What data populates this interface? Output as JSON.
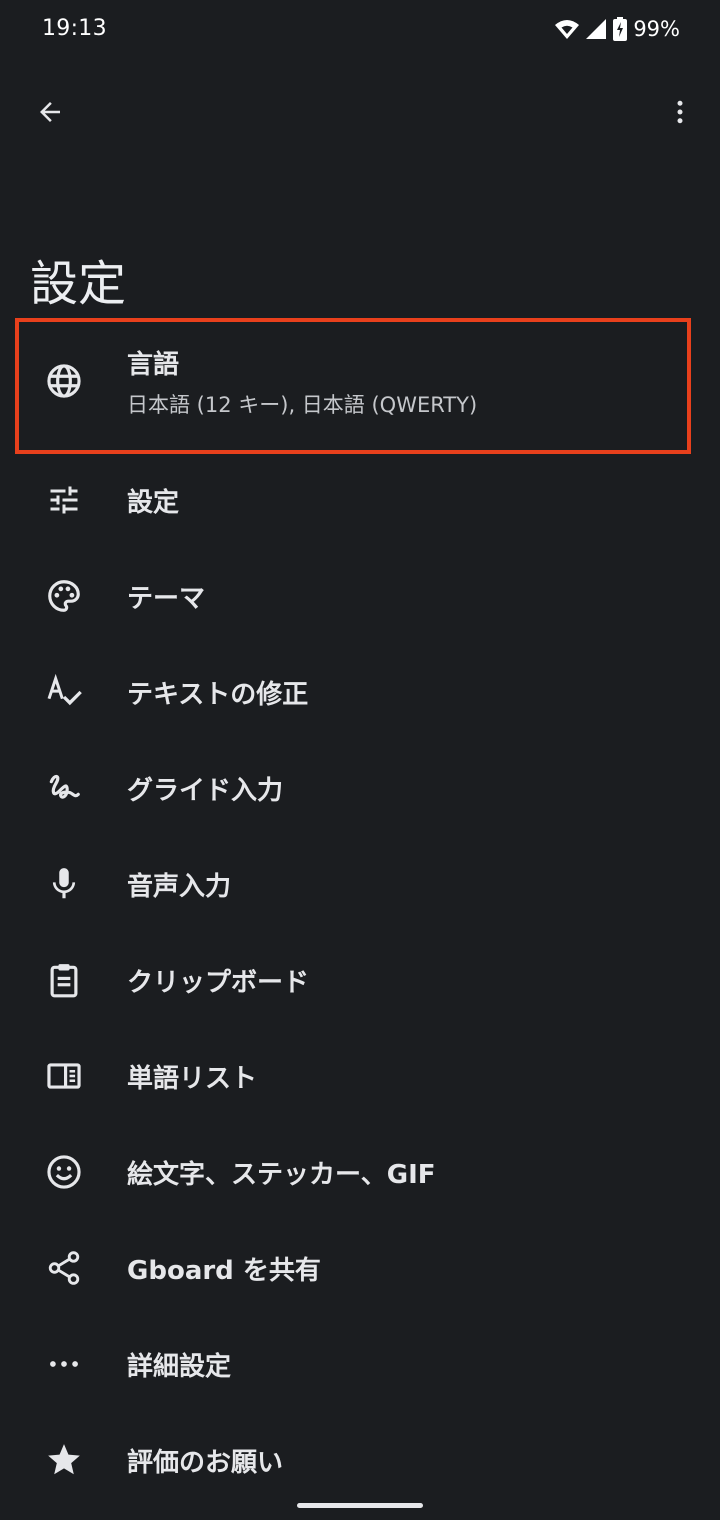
{
  "status_bar": {
    "time": "19:13",
    "battery": "99%"
  },
  "page": {
    "title": "設定"
  },
  "settings": [
    {
      "icon": "globe-icon",
      "title": "言語",
      "subtitle": "日本語 (12 キー), 日本語 (QWERTY)",
      "highlighted": true
    },
    {
      "icon": "tune-icon",
      "title": "設定"
    },
    {
      "icon": "palette-icon",
      "title": "テーマ"
    },
    {
      "icon": "spellcheck-icon",
      "title": "テキストの修正"
    },
    {
      "icon": "gesture-icon",
      "title": "グライド入力"
    },
    {
      "icon": "microphone-icon",
      "title": "音声入力"
    },
    {
      "icon": "clipboard-icon",
      "title": "クリップボード"
    },
    {
      "icon": "dictionary-icon",
      "title": "単語リスト"
    },
    {
      "icon": "emoji-icon",
      "title": "絵文字、ステッカー、GIF"
    },
    {
      "icon": "share-icon",
      "title": "Gboard を共有"
    },
    {
      "icon": "more-horizontal-icon",
      "title": "詳細設定"
    },
    {
      "icon": "star-icon",
      "title": "評価のお願い"
    }
  ],
  "colors": {
    "background": "#1b1d20",
    "text": "#e6e7ea",
    "highlight": "#e8401c"
  }
}
